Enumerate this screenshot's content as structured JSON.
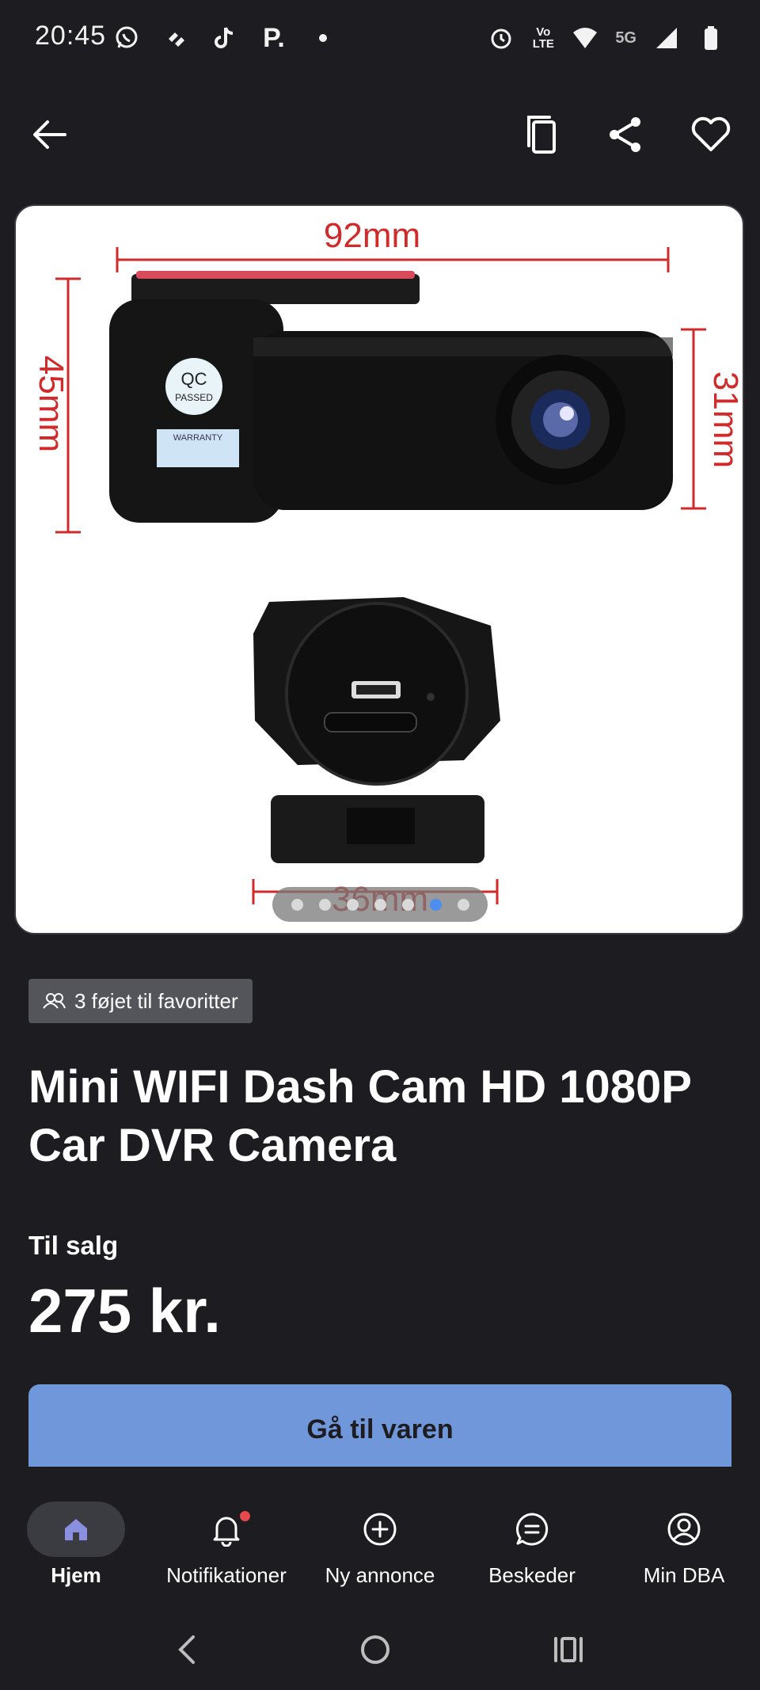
{
  "status_bar": {
    "time": "20:45",
    "left_icons": [
      "whatsapp-icon",
      "tidal-icon",
      "tiktok-icon",
      "parking-icon",
      "dot-icon"
    ],
    "right_icons": [
      "alarm-icon",
      "volte-icon",
      "wifi-icon",
      "5g-icon",
      "signal-icon",
      "battery-icon"
    ],
    "volte_text": "Vo LTE",
    "network_text": "5G"
  },
  "app_bar": {
    "back_icon": "arrow-left-icon",
    "actions": [
      "copy-icon",
      "share-icon",
      "heart-icon"
    ]
  },
  "gallery": {
    "image_labels": {
      "width": "92mm",
      "height": "45mm",
      "depth": "31mm",
      "base": "36mm",
      "qc": "QC",
      "qc_sub": "PASSED",
      "warranty": "WARRANTY"
    },
    "page_count": 7,
    "active_index": 5
  },
  "listing": {
    "favorites_text": "3 føjet til favoritter",
    "title": "Mini WIFI Dash Cam HD 1080P Car DVR Camera",
    "sale_label": "Til salg",
    "price": "275 kr.",
    "cta_label": "Gå til varen"
  },
  "bottom_nav": {
    "items": [
      {
        "label": "Hjem",
        "icon": "home-icon",
        "active": true
      },
      {
        "label": "Notifikationer",
        "icon": "bell-icon",
        "active": false
      },
      {
        "label": "Ny annonce",
        "icon": "plus-circle-icon",
        "active": false
      },
      {
        "label": "Beskeder",
        "icon": "chat-icon",
        "active": false
      },
      {
        "label": "Min DBA",
        "icon": "user-circle-icon",
        "active": false
      }
    ]
  },
  "colors": {
    "background": "#1d1c21",
    "accent": "#7097da",
    "active_dot": "#4c8ff0",
    "notification": "#e5484d",
    "dimension_red": "#d02a2a"
  }
}
